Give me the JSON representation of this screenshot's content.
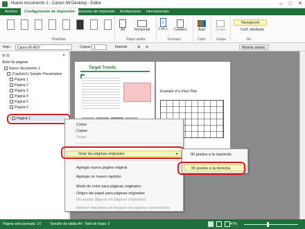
{
  "window": {
    "title": "Nuevo documento 1 - Canon iW Desktop - Editor"
  },
  "ribbon_tabs": [
    "Archivo",
    "Configuración de impresión",
    "Opciones de impresión",
    "Anotaciones",
    "Herramientas"
  ],
  "ribbon": {
    "groups": {
      "plantillas": "Plantillas",
      "papel": "Papel salida",
      "formato": "Formato",
      "color": "Color",
      "grapa": "Grapa",
      "ver": "Ver"
    },
    "buttons": {
      "paper_size": "A4",
      "orientation": "Horizontal",
      "layout": "1 en 1",
      "finishing": "Cuadern",
      "color_mode": "Auto",
      "staple": "Grapa",
      "navigation": "Navegación",
      "detailed_config": "Conf. detallada"
    }
  },
  "toolbar": {
    "printer_label": "Impr.:",
    "printer_value": "Canon iR-ADV",
    "copies_label": "Copias",
    "copies_value": "1",
    "print_button": "Imprimir",
    "zoom_buttons": [
      "⊕",
      "⊖"
    ],
    "show_annotations": "Mostrar anotac."
  },
  "left_panel": {
    "title": "Árbol de páginas",
    "tree": [
      "Nuevo documento 1",
      "(Capítulo1) Sample Presentation",
      "Página 1",
      "Página 2",
      "Página 3",
      "Página 4",
      "Página 5",
      "Página 6"
    ],
    "selected_item": "Página 1"
  },
  "document": {
    "page1_heading": "Target Trends",
    "page2_caption": "Example of a Floor Plan"
  },
  "context_menu": {
    "items": [
      {
        "label": "Cortar",
        "disabled": false
      },
      {
        "label": "Copiar",
        "disabled": false
      },
      {
        "label": "Pegar",
        "disabled": true
      },
      {
        "label": "Girar las páginas originales",
        "disabled": false,
        "highlighted": true
      },
      {
        "label": "Agregar nueva página original",
        "disabled": false
      },
      {
        "label": "Agregar un nuevo capítulo",
        "disabled": false
      },
      {
        "label": "Modo de color para páginas originales",
        "disabled": false
      },
      {
        "label": "Origen del papel para páginas originales",
        "disabled": false
      },
      {
        "label": "No ajustar (figuras en páginas originales)",
        "disabled": true
      },
      {
        "label": "Reducir márgenes de bloques en páginas consecutivas",
        "disabled": true
      }
    ],
    "submenu": [
      {
        "label": "90 grados a la izquierda",
        "highlighted": false
      },
      {
        "label": "90 grados a la derecha",
        "highlighted": true
      }
    ]
  },
  "status_bar": {
    "selected_pages": "Página seleccionada: 1/7",
    "output_size": "Tamaño de salida:A4",
    "sheets": "Total de hojas: 2",
    "zoom": "47%"
  },
  "colors": {
    "brand_green": "#1f6f3a",
    "highlight": "#fdf6c3",
    "annotation_red": "#e0181b"
  }
}
